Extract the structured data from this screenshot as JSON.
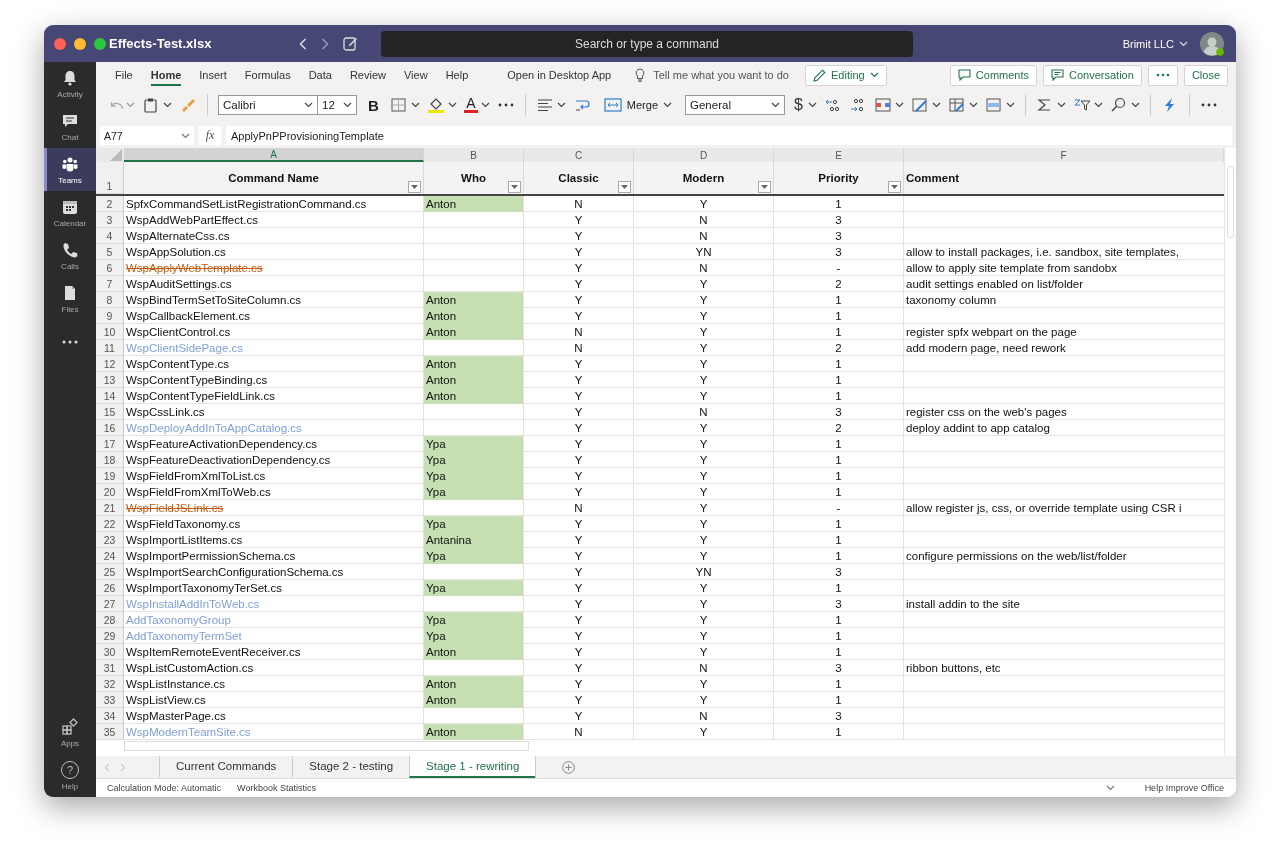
{
  "window": {
    "title": "Effects-Test.xlsx",
    "search_placeholder": "Search or type a command",
    "org": "Brimit LLC"
  },
  "rail": {
    "items": [
      {
        "kind": "bell",
        "label": "Activity",
        "selected": false
      },
      {
        "kind": "chat",
        "label": "Chat",
        "selected": false
      },
      {
        "kind": "teams",
        "label": "Teams",
        "selected": true
      },
      {
        "kind": "calendar",
        "label": "Calendar",
        "selected": false
      },
      {
        "kind": "phone",
        "label": "Calls",
        "selected": false
      },
      {
        "kind": "file",
        "label": "Files",
        "selected": false
      },
      {
        "kind": "more",
        "selected": false
      }
    ],
    "bottom": [
      {
        "kind": "apps",
        "label": "Apps"
      },
      {
        "kind": "help",
        "glyph": "?",
        "label": "Help"
      }
    ]
  },
  "ribbon": {
    "tabs": [
      {
        "label": "File",
        "selected": false
      },
      {
        "label": "Home",
        "selected": true
      },
      {
        "label": "Insert",
        "selected": false
      },
      {
        "label": "Formulas",
        "selected": false
      },
      {
        "label": "Data",
        "selected": false
      },
      {
        "label": "Review",
        "selected": false
      },
      {
        "label": "View",
        "selected": false
      },
      {
        "label": "Help",
        "selected": false
      }
    ],
    "open_desktop": "Open in Desktop App",
    "tell_me": "Tell me what you want to do",
    "mode": "Editing",
    "comments": "Comments",
    "conversation": "Conversation",
    "close": "Close"
  },
  "toolbar": {
    "font": "Calibri",
    "font_size": "12",
    "bold": "B",
    "font_color": "A",
    "merge": "Merge",
    "number_format": "General",
    "currency": "$"
  },
  "formula_bar": {
    "name_box": "A77",
    "fx": "fx",
    "formula": "ApplyPnPProvisioningTemplate"
  },
  "sheet": {
    "columns": [
      {
        "letter": "A",
        "title": "Command Name",
        "selected": true,
        "filter": true
      },
      {
        "letter": "B",
        "title": "Who",
        "selected": false,
        "filter": true
      },
      {
        "letter": "C",
        "title": "Classic",
        "selected": false,
        "filter": true
      },
      {
        "letter": "D",
        "title": "Modern",
        "selected": false,
        "filter": true
      },
      {
        "letter": "E",
        "title": "Priority",
        "selected": false,
        "filter": true
      },
      {
        "letter": "F",
        "title": "Comment",
        "selected": false,
        "filter": false
      }
    ],
    "header_row": "1",
    "rows": [
      {
        "row": "2",
        "name": "SpfxCommandSetListRegistrationCommand.cs",
        "kind": "plain",
        "who": "Anton",
        "classic": "N",
        "modern": "Y",
        "priority": "1"
      },
      {
        "row": "3",
        "name": "WspAddWebPartEffect.cs",
        "kind": "plain",
        "classic": "Y",
        "modern": "N",
        "priority": "3"
      },
      {
        "row": "4",
        "name": "WspAlternateCss.cs",
        "kind": "plain",
        "classic": "Y",
        "modern": "N",
        "priority": "3"
      },
      {
        "row": "5",
        "name": "WspAppSolution.cs",
        "kind": "plain",
        "classic": "Y",
        "modern": "YN",
        "priority": "3",
        "comment": "allow to install packages, i.e. sandbox, site templates,"
      },
      {
        "row": "6",
        "name": "WspApplyWebTemplate.cs",
        "kind": "struck",
        "classic": "Y",
        "modern": "N",
        "priority": "-",
        "comment": "allow to apply site template from sandobx"
      },
      {
        "row": "7",
        "name": "WspAuditSettings.cs",
        "kind": "plain",
        "classic": "Y",
        "modern": "Y",
        "priority": "2",
        "comment": "audit settings enabled on list/folder"
      },
      {
        "row": "8",
        "name": "WspBindTermSetToSiteColumn.cs",
        "kind": "plain",
        "who": "Anton",
        "classic": "Y",
        "modern": "Y",
        "priority": "1",
        "comment": "taxonomy column"
      },
      {
        "row": "9",
        "name": "WspCallbackElement.cs",
        "kind": "plain",
        "who": "Anton",
        "classic": "Y",
        "modern": "Y",
        "priority": "1"
      },
      {
        "row": "10",
        "name": "WspClientControl.cs",
        "kind": "plain",
        "who": "Anton",
        "classic": "N",
        "modern": "Y",
        "priority": "1",
        "comment": "register spfx webpart on the page"
      },
      {
        "row": "11",
        "name": "WspClientSidePage.cs",
        "kind": "blue",
        "classic": "N",
        "modern": "Y",
        "priority": "2",
        "comment": "add modern page, need rework"
      },
      {
        "row": "12",
        "name": "WspContentType.cs",
        "kind": "plain",
        "who": "Anton",
        "classic": "Y",
        "modern": "Y",
        "priority": "1"
      },
      {
        "row": "13",
        "name": "WspContentTypeBinding.cs",
        "kind": "plain",
        "who": "Anton",
        "classic": "Y",
        "modern": "Y",
        "priority": "1"
      },
      {
        "row": "14",
        "name": "WspContentTypeFieldLink.cs",
        "kind": "plain",
        "who": "Anton",
        "classic": "Y",
        "modern": "Y",
        "priority": "1"
      },
      {
        "row": "15",
        "name": "WspCssLink.cs",
        "kind": "plain",
        "classic": "Y",
        "modern": "N",
        "priority": "3",
        "comment": "register css on the web's pages"
      },
      {
        "row": "16",
        "name": "WspDeployAddInToAppCatalog.cs",
        "kind": "blue",
        "classic": "Y",
        "modern": "Y",
        "priority": "2",
        "comment": "deploy addint to app catalog"
      },
      {
        "row": "17",
        "name": "WspFeatureActivationDependency.cs",
        "kind": "plain",
        "who": "Ypa",
        "classic": "Y",
        "modern": "Y",
        "priority": "1"
      },
      {
        "row": "18",
        "name": "WspFeatureDeactivationDependency.cs",
        "kind": "plain",
        "who": "Ypa",
        "classic": "Y",
        "modern": "Y",
        "priority": "1"
      },
      {
        "row": "19",
        "name": "WspFieldFromXmlToList.cs",
        "kind": "plain",
        "who": "Ypa",
        "classic": "Y",
        "modern": "Y",
        "priority": "1"
      },
      {
        "row": "20",
        "name": "WspFieldFromXmlToWeb.cs",
        "kind": "plain",
        "who": "Ypa",
        "classic": "Y",
        "modern": "Y",
        "priority": "1"
      },
      {
        "row": "21",
        "name": "WspFieldJSLink.cs",
        "kind": "struck",
        "classic": "N",
        "modern": "Y",
        "priority": "-",
        "comment": "allow register js, css, or override template using CSR i"
      },
      {
        "row": "22",
        "name": "WspFieldTaxonomy.cs",
        "kind": "plain",
        "who": "Ypa",
        "classic": "Y",
        "modern": "Y",
        "priority": "1"
      },
      {
        "row": "23",
        "name": "WspImportListItems.cs",
        "kind": "plain",
        "who": "Antanina",
        "classic": "Y",
        "modern": "Y",
        "priority": "1"
      },
      {
        "row": "24",
        "name": "WspImportPermissionSchema.cs",
        "kind": "plain",
        "who": "Ypa",
        "classic": "Y",
        "modern": "Y",
        "priority": "1",
        "comment": "configure permissions on the web/list/folder"
      },
      {
        "row": "25",
        "name": "WspImportSearchConfigurationSchema.cs",
        "kind": "plain",
        "classic": "Y",
        "modern": "YN",
        "priority": "3"
      },
      {
        "row": "26",
        "name": "WspImportTaxonomyTerSet.cs",
        "kind": "plain",
        "who": "Ypa",
        "classic": "Y",
        "modern": "Y",
        "priority": "1"
      },
      {
        "row": "27",
        "name": "WspInstallAddInToWeb.cs",
        "kind": "blue",
        "classic": "Y",
        "modern": "Y",
        "priority": "3",
        "comment": "install addin to the site"
      },
      {
        "row": "28",
        "name": "AddTaxonomyGroup",
        "kind": "blue",
        "who": "Ypa",
        "classic": "Y",
        "modern": "Y",
        "priority": "1"
      },
      {
        "row": "29",
        "name": "AddTaxonomyTermSet",
        "kind": "blue",
        "who": "Ypa",
        "classic": "Y",
        "modern": "Y",
        "priority": "1"
      },
      {
        "row": "30",
        "name": "WspItemRemoteEventReceiver.cs",
        "kind": "plain",
        "who": "Anton",
        "classic": "Y",
        "modern": "Y",
        "priority": "1"
      },
      {
        "row": "31",
        "name": "WspListCustomAction.cs",
        "kind": "plain",
        "classic": "Y",
        "modern": "N",
        "priority": "3",
        "comment": "ribbon buttons, etc"
      },
      {
        "row": "32",
        "name": "WspListInstance.cs",
        "kind": "plain",
        "who": "Anton",
        "classic": "Y",
        "modern": "Y",
        "priority": "1"
      },
      {
        "row": "33",
        "name": "WspListView.cs",
        "kind": "plain",
        "who": "Anton",
        "classic": "Y",
        "modern": "Y",
        "priority": "1"
      },
      {
        "row": "34",
        "name": "WspMasterPage.cs",
        "kind": "plain",
        "classic": "Y",
        "modern": "N",
        "priority": "3"
      },
      {
        "row": "35",
        "name": "WspModernTeamSite.cs",
        "kind": "blue",
        "who": "Anton",
        "classic": "N",
        "modern": "Y",
        "priority": "1"
      }
    ]
  },
  "sheet_tabs": [
    {
      "label": "Current Commands",
      "selected": false
    },
    {
      "label": "Stage 2 - testing",
      "selected": false
    },
    {
      "label": "Stage 1 - rewriting",
      "selected": true
    }
  ],
  "status_bar": {
    "calc_mode": "Calculation Mode: Automatic",
    "stats": "Workbook Statistics",
    "help": "Help Improve Office"
  }
}
